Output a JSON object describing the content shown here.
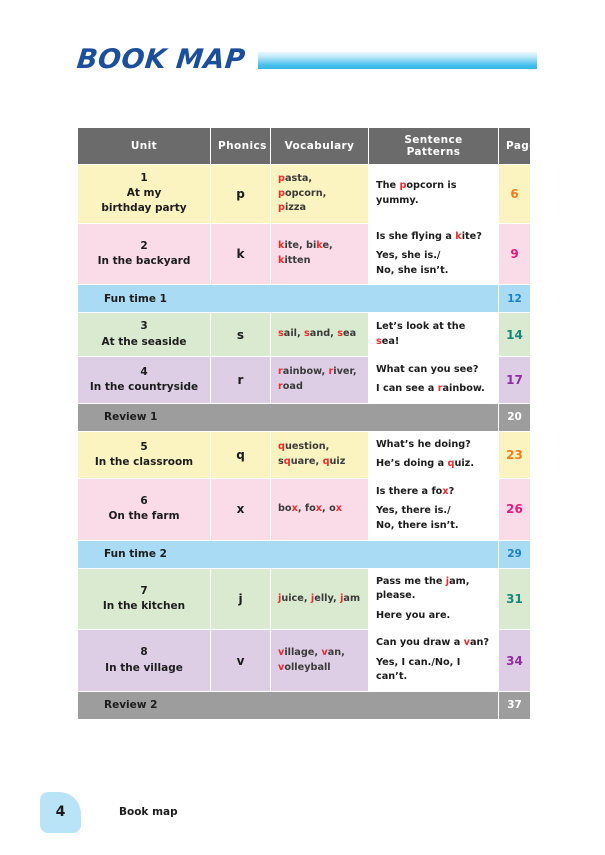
{
  "header": {
    "title": "BOOK MAP",
    "bar_color": "#46bfea",
    "title_color": "#1b4f9c"
  },
  "table": {
    "columns": [
      "Unit",
      "Phonics",
      "Vocabulary",
      "Sentence Patterns",
      "Page"
    ],
    "header_bg": "#6b6b6b",
    "highlight_color": "#ee2b2b",
    "rows": [
      {
        "type": "unit",
        "theme": "yellow",
        "bg": "#fcf4c0",
        "number": "1",
        "title_line1": "At my",
        "title_line2": "birthday party",
        "phonics": "p",
        "vocabulary": [
          [
            [
              "p",
              "hl"
            ],
            [
              "asta,",
              "n"
            ]
          ],
          [
            [
              "p",
              "hl"
            ],
            [
              "opcorn,",
              "n"
            ]
          ],
          [
            [
              "p",
              "hl"
            ],
            [
              "izza",
              "n"
            ]
          ]
        ],
        "sentences": [
          {
            "gap": false,
            "parts": [
              [
                "The ",
                "n"
              ],
              [
                "p",
                "hl"
              ],
              [
                "opcorn is",
                "n"
              ]
            ]
          },
          {
            "gap": false,
            "parts": [
              [
                "yummy.",
                "n"
              ]
            ]
          }
        ],
        "page": "6",
        "page_color": "#f07d1e"
      },
      {
        "type": "unit",
        "theme": "pink",
        "bg": "#fadbe8",
        "number": "2",
        "title_line1": "In the backyard",
        "title_line2": "",
        "phonics": "k",
        "vocabulary": [
          [
            [
              "k",
              "hl"
            ],
            [
              "ite, bi",
              "n"
            ],
            [
              "k",
              "hl"
            ],
            [
              "e,",
              "n"
            ]
          ],
          [
            [
              "k",
              "hl"
            ],
            [
              "itten",
              "n"
            ]
          ]
        ],
        "sentences": [
          {
            "gap": false,
            "parts": [
              [
                "Is she flying a ",
                "n"
              ],
              [
                "k",
                "hl"
              ],
              [
                "ite?",
                "n"
              ]
            ]
          },
          {
            "gap": true,
            "parts": [
              [
                "Yes, she is./",
                "n"
              ]
            ]
          },
          {
            "gap": false,
            "parts": [
              [
                "No, she isn’t.",
                "n"
              ]
            ]
          }
        ],
        "page": "9",
        "page_color": "#e5197f"
      },
      {
        "type": "band",
        "theme": "blue",
        "bg": "#a9dcf4",
        "label": "Fun time 1",
        "page": "12",
        "page_color": "#1b7fc4"
      },
      {
        "type": "unit",
        "theme": "green",
        "bg": "#d9ead0",
        "number": "3",
        "title_line1": "At the seaside",
        "title_line2": "",
        "phonics": "s",
        "vocabulary": [
          [
            [
              "s",
              "hl"
            ],
            [
              "ail, ",
              "n"
            ],
            [
              "s",
              "hl"
            ],
            [
              "and, ",
              "n"
            ],
            [
              "s",
              "hl"
            ],
            [
              "ea",
              "n"
            ]
          ]
        ],
        "sentences": [
          {
            "gap": false,
            "parts": [
              [
                "Let’s look at the ",
                "n"
              ],
              [
                "s",
                "hl"
              ],
              [
                "ea!",
                "n"
              ]
            ]
          }
        ],
        "page": "14",
        "page_color": "#16887c"
      },
      {
        "type": "unit",
        "theme": "purple",
        "bg": "#ddcee6",
        "number": "4",
        "title_line1": "In the countryside",
        "title_line2": "",
        "phonics": "r",
        "vocabulary": [
          [
            [
              "r",
              "hl"
            ],
            [
              "ainbow, ",
              "n"
            ],
            [
              "r",
              "hl"
            ],
            [
              "iver,",
              "n"
            ]
          ],
          [
            [
              "r",
              "hl"
            ],
            [
              "oad",
              "n"
            ]
          ]
        ],
        "sentences": [
          {
            "gap": false,
            "parts": [
              [
                "What can you see?",
                "n"
              ]
            ]
          },
          {
            "gap": true,
            "parts": [
              [
                "I can see a ",
                "n"
              ],
              [
                "r",
                "hl"
              ],
              [
                "ainbow.",
                "n"
              ]
            ]
          }
        ],
        "page": "17",
        "page_color": "#8c2fa0"
      },
      {
        "type": "band",
        "theme": "gray",
        "bg": "#9d9d9d",
        "label": "Review 1",
        "page": "20",
        "page_color": "#ffffff"
      },
      {
        "type": "unit",
        "theme": "yellow",
        "bg": "#fcf4c0",
        "number": "5",
        "title_line1": "In the classroom",
        "title_line2": "",
        "phonics": "q",
        "vocabulary": [
          [
            [
              "q",
              "hl"
            ],
            [
              "uestion,",
              "n"
            ]
          ],
          [
            [
              "s",
              "n"
            ],
            [
              "q",
              "hl"
            ],
            [
              "uare, ",
              "n"
            ],
            [
              "q",
              "hl"
            ],
            [
              "uiz",
              "n"
            ]
          ]
        ],
        "sentences": [
          {
            "gap": false,
            "parts": [
              [
                "What’s he doing?",
                "n"
              ]
            ]
          },
          {
            "gap": true,
            "parts": [
              [
                "He’s doing a ",
                "n"
              ],
              [
                "q",
                "hl"
              ],
              [
                "uiz.",
                "n"
              ]
            ]
          }
        ],
        "page": "23",
        "page_color": "#f07d1e"
      },
      {
        "type": "unit",
        "theme": "pink",
        "bg": "#fadbe8",
        "number": "6",
        "title_line1": "On the farm",
        "title_line2": "",
        "phonics": "x",
        "vocabulary": [
          [
            [
              "bo",
              "n"
            ],
            [
              "x",
              "hl"
            ],
            [
              ", fo",
              "n"
            ],
            [
              "x",
              "hl"
            ],
            [
              ", o",
              "n"
            ],
            [
              "x",
              "hl"
            ]
          ]
        ],
        "sentences": [
          {
            "gap": false,
            "parts": [
              [
                "Is there a fo",
                "n"
              ],
              [
                "x",
                "hl"
              ],
              [
                "?",
                "n"
              ]
            ]
          },
          {
            "gap": true,
            "parts": [
              [
                "Yes, there is./",
                "n"
              ]
            ]
          },
          {
            "gap": false,
            "parts": [
              [
                "No, there isn’t.",
                "n"
              ]
            ]
          }
        ],
        "page": "26",
        "page_color": "#e5197f"
      },
      {
        "type": "band",
        "theme": "blue",
        "bg": "#a9dcf4",
        "label": "Fun time 2",
        "page": "29",
        "page_color": "#1b7fc4"
      },
      {
        "type": "unit",
        "theme": "green",
        "bg": "#d9ead0",
        "number": "7",
        "title_line1": "In the kitchen",
        "title_line2": "",
        "phonics": "j",
        "vocabulary": [
          [
            [
              "j",
              "hl"
            ],
            [
              "uice, ",
              "n"
            ],
            [
              "j",
              "hl"
            ],
            [
              "elly, ",
              "n"
            ],
            [
              "j",
              "hl"
            ],
            [
              "am",
              "n"
            ]
          ]
        ],
        "sentences": [
          {
            "gap": false,
            "parts": [
              [
                "Pass me the ",
                "n"
              ],
              [
                "j",
                "hl"
              ],
              [
                "am,",
                "n"
              ]
            ]
          },
          {
            "gap": false,
            "parts": [
              [
                "please.",
                "n"
              ]
            ]
          },
          {
            "gap": true,
            "parts": [
              [
                "Here you are.",
                "n"
              ]
            ]
          }
        ],
        "page": "31",
        "page_color": "#16887c"
      },
      {
        "type": "unit",
        "theme": "purple",
        "bg": "#ddcee6",
        "number": "8",
        "title_line1": "In the village",
        "title_line2": "",
        "phonics": "v",
        "vocabulary": [
          [
            [
              "v",
              "hl"
            ],
            [
              "illage, ",
              "n"
            ],
            [
              "v",
              "hl"
            ],
            [
              "an,",
              "n"
            ]
          ],
          [
            [
              "v",
              "hl"
            ],
            [
              "olleyball",
              "n"
            ]
          ]
        ],
        "sentences": [
          {
            "gap": false,
            "parts": [
              [
                "Can you draw a ",
                "n"
              ],
              [
                "v",
                "hl"
              ],
              [
                "an?",
                "n"
              ]
            ]
          },
          {
            "gap": true,
            "parts": [
              [
                "Yes, I can./No, I can’t.",
                "n"
              ]
            ]
          }
        ],
        "page": "34",
        "page_color": "#8c2fa0"
      },
      {
        "type": "band",
        "theme": "gray",
        "bg": "#9d9d9d",
        "label": "Review 2",
        "page": "37",
        "page_color": "#ffffff"
      }
    ]
  },
  "footer": {
    "page_number": "4",
    "label": "Book map",
    "badge_color": "#b9e3f7"
  }
}
